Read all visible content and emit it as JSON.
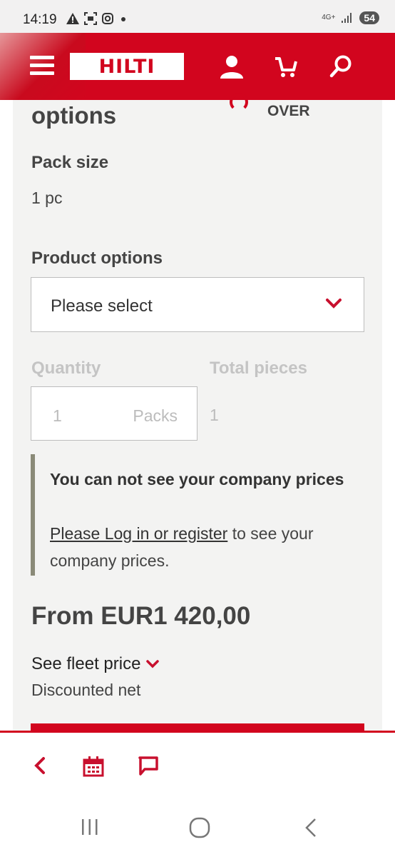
{
  "status_bar": {
    "time": "14:19",
    "network": "4G+",
    "battery": "54"
  },
  "header": {
    "logo_text": "HILTI"
  },
  "content": {
    "section_title": "options",
    "badge_text": "OVER",
    "pack_size_label": "Pack size",
    "pack_size_value": "1 pc",
    "product_options_label": "Product options",
    "product_options_placeholder": "Please select",
    "quantity_label": "Quantity",
    "quantity_value": "1",
    "quantity_unit": "Packs",
    "total_pieces_label": "Total pieces",
    "total_pieces_value": "1",
    "notice": {
      "title": "You can not see your company prices",
      "link_text": "Please Log in or register",
      "body_after_link": " to see your company prices."
    },
    "price": "From EUR1 420,00",
    "fleet_price_label": "See fleet price",
    "discount_label": "Discounted net"
  },
  "colors": {
    "brand_red": "#d2051e",
    "notice_border": "#8a8a78"
  }
}
